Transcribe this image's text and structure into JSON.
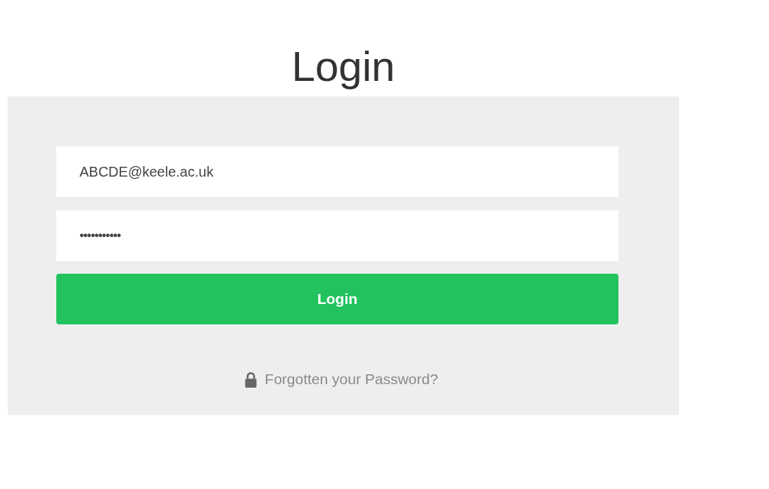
{
  "title": "Login",
  "email_field": {
    "value": "ABCDE@keele.ac.uk"
  },
  "password_field": {
    "value": "•••••••••••"
  },
  "login_button": {
    "label": "Login"
  },
  "forgot_link": {
    "label": "Forgotten your Password?"
  }
}
